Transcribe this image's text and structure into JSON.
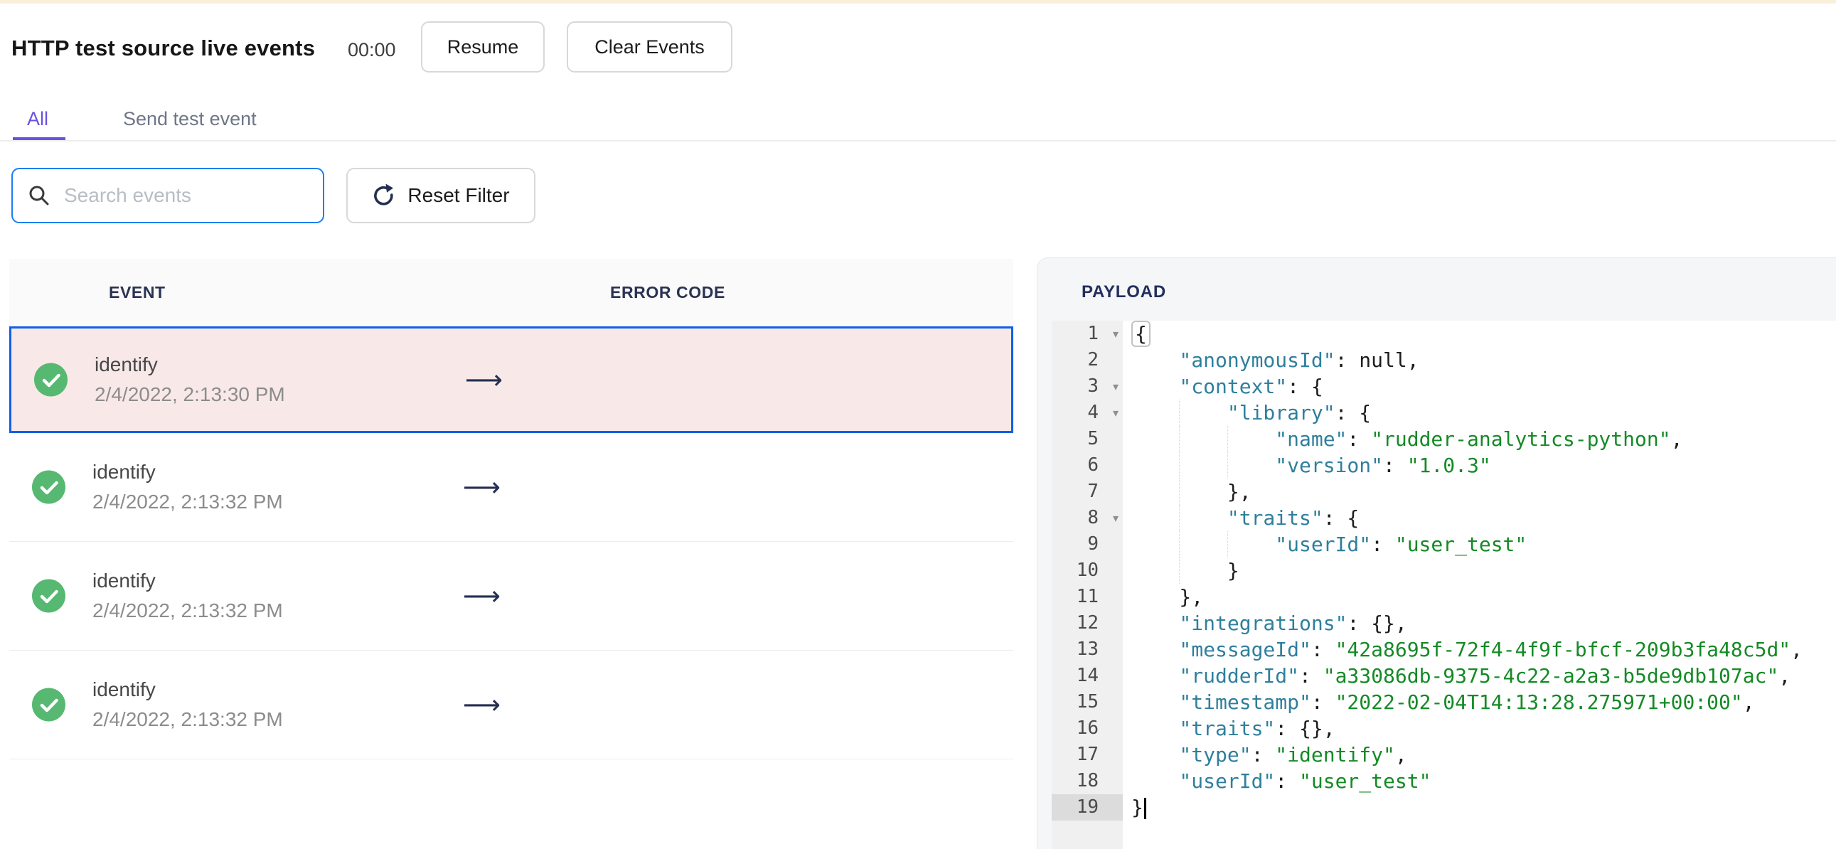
{
  "header": {
    "title": "HTTP test source live events",
    "timer": "00:00",
    "resume_label": "Resume",
    "clear_label": "Clear Events"
  },
  "tabs": [
    {
      "label": "All",
      "active": true
    },
    {
      "label": "Send test event",
      "active": false
    }
  ],
  "filters": {
    "search_placeholder": "Search events",
    "reset_label": "Reset Filter"
  },
  "events_table": {
    "columns": [
      "EVENT",
      "ERROR CODE"
    ],
    "rows": [
      {
        "name": "identify",
        "time": "2/4/2022, 2:13:30 PM",
        "selected": true
      },
      {
        "name": "identify",
        "time": "2/4/2022, 2:13:32 PM",
        "selected": false
      },
      {
        "name": "identify",
        "time": "2/4/2022, 2:13:32 PM",
        "selected": false
      },
      {
        "name": "identify",
        "time": "2/4/2022, 2:13:32 PM",
        "selected": false
      }
    ]
  },
  "payload": {
    "title": "PAYLOAD",
    "active_line": 19,
    "lines": [
      {
        "n": 1,
        "indent": 0,
        "fold": true,
        "tokens": [
          {
            "t": "b",
            "v": "{"
          }
        ]
      },
      {
        "n": 2,
        "indent": 4,
        "fold": false,
        "tokens": [
          {
            "t": "k",
            "v": "\"anonymousId\""
          },
          {
            "t": "p",
            "v": ": null,"
          }
        ]
      },
      {
        "n": 3,
        "indent": 4,
        "fold": true,
        "tokens": [
          {
            "t": "k",
            "v": "\"context\""
          },
          {
            "t": "p",
            "v": ": {"
          }
        ]
      },
      {
        "n": 4,
        "indent": 8,
        "fold": true,
        "tokens": [
          {
            "t": "k",
            "v": "\"library\""
          },
          {
            "t": "p",
            "v": ": {"
          }
        ]
      },
      {
        "n": 5,
        "indent": 12,
        "fold": false,
        "tokens": [
          {
            "t": "k",
            "v": "\"name\""
          },
          {
            "t": "p",
            "v": ": "
          },
          {
            "t": "s",
            "v": "\"rudder-analytics-python\""
          },
          {
            "t": "p",
            "v": ","
          }
        ]
      },
      {
        "n": 6,
        "indent": 12,
        "fold": false,
        "tokens": [
          {
            "t": "k",
            "v": "\"version\""
          },
          {
            "t": "p",
            "v": ": "
          },
          {
            "t": "s",
            "v": "\"1.0.3\""
          }
        ]
      },
      {
        "n": 7,
        "indent": 8,
        "fold": false,
        "tokens": [
          {
            "t": "p",
            "v": "},"
          }
        ]
      },
      {
        "n": 8,
        "indent": 8,
        "fold": true,
        "tokens": [
          {
            "t": "k",
            "v": "\"traits\""
          },
          {
            "t": "p",
            "v": ": {"
          }
        ]
      },
      {
        "n": 9,
        "indent": 12,
        "fold": false,
        "tokens": [
          {
            "t": "k",
            "v": "\"userId\""
          },
          {
            "t": "p",
            "v": ": "
          },
          {
            "t": "s",
            "v": "\"user_test\""
          }
        ]
      },
      {
        "n": 10,
        "indent": 8,
        "fold": false,
        "tokens": [
          {
            "t": "p",
            "v": "}"
          }
        ]
      },
      {
        "n": 11,
        "indent": 4,
        "fold": false,
        "tokens": [
          {
            "t": "p",
            "v": "},"
          }
        ]
      },
      {
        "n": 12,
        "indent": 4,
        "fold": false,
        "tokens": [
          {
            "t": "k",
            "v": "\"integrations\""
          },
          {
            "t": "p",
            "v": ": {},"
          }
        ]
      },
      {
        "n": 13,
        "indent": 4,
        "fold": false,
        "tokens": [
          {
            "t": "k",
            "v": "\"messageId\""
          },
          {
            "t": "p",
            "v": ": "
          },
          {
            "t": "s",
            "v": "\"42a8695f-72f4-4f9f-bfcf-209b3fa48c5d\""
          },
          {
            "t": "p",
            "v": ","
          }
        ]
      },
      {
        "n": 14,
        "indent": 4,
        "fold": false,
        "tokens": [
          {
            "t": "k",
            "v": "\"rudderId\""
          },
          {
            "t": "p",
            "v": ": "
          },
          {
            "t": "s",
            "v": "\"a33086db-9375-4c22-a2a3-b5de9db107ac\""
          },
          {
            "t": "p",
            "v": ","
          }
        ]
      },
      {
        "n": 15,
        "indent": 4,
        "fold": false,
        "tokens": [
          {
            "t": "k",
            "v": "\"timestamp\""
          },
          {
            "t": "p",
            "v": ": "
          },
          {
            "t": "s",
            "v": "\"2022-02-04T14:13:28.275971+00:00\""
          },
          {
            "t": "p",
            "v": ","
          }
        ]
      },
      {
        "n": 16,
        "indent": 4,
        "fold": false,
        "tokens": [
          {
            "t": "k",
            "v": "\"traits\""
          },
          {
            "t": "p",
            "v": ": {},"
          }
        ]
      },
      {
        "n": 17,
        "indent": 4,
        "fold": false,
        "tokens": [
          {
            "t": "k",
            "v": "\"type\""
          },
          {
            "t": "p",
            "v": ": "
          },
          {
            "t": "s",
            "v": "\"identify\""
          },
          {
            "t": "p",
            "v": ","
          }
        ]
      },
      {
        "n": 18,
        "indent": 4,
        "fold": false,
        "tokens": [
          {
            "t": "k",
            "v": "\"userId\""
          },
          {
            "t": "p",
            "v": ": "
          },
          {
            "t": "s",
            "v": "\"user_test\""
          }
        ]
      },
      {
        "n": 19,
        "indent": 0,
        "fold": false,
        "cursor": true,
        "tokens": [
          {
            "t": "p",
            "v": "}"
          }
        ]
      }
    ]
  },
  "icons": {
    "arrow": "⟶",
    "fold": "▾"
  },
  "colors": {
    "accent_purple": "#6a52e0",
    "focus_blue": "#1b7ef2",
    "selected_row_border": "#115fe8",
    "selected_row_bg": "#f8e9e8",
    "success_green": "#57b871",
    "navy": "#262f52",
    "code_key": "#2e7f9d",
    "code_string": "#148a25",
    "top_strip": "#faf0da"
  }
}
